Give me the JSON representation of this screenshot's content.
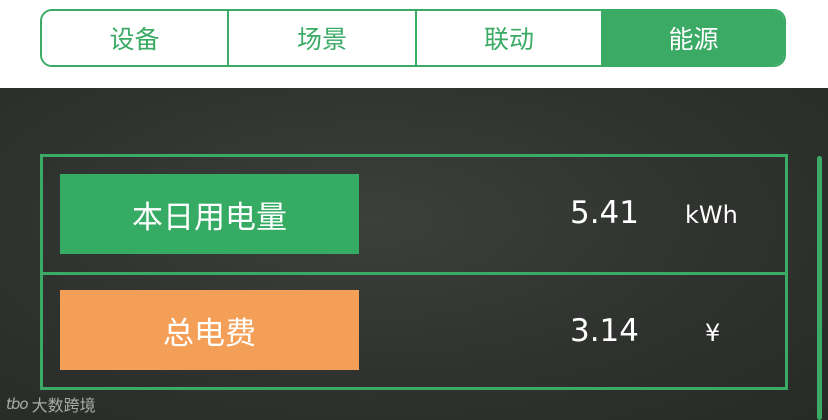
{
  "tabs": [
    {
      "label": "设备",
      "active": false
    },
    {
      "label": "场景",
      "active": false
    },
    {
      "label": "联动",
      "active": false
    },
    {
      "label": "能源",
      "active": true
    }
  ],
  "energy": {
    "daily_usage": {
      "label": "本日用电量",
      "value": "5.41",
      "unit": "kWh"
    },
    "total_cost": {
      "label": "总电费",
      "value": "3.14",
      "unit": "¥"
    }
  },
  "watermark": {
    "logo": "tbo",
    "text": "大数跨境"
  },
  "colors": {
    "accent_green": "#3aaa64",
    "cost_orange": "#f49f57",
    "panel_dark": "#2f322e"
  }
}
